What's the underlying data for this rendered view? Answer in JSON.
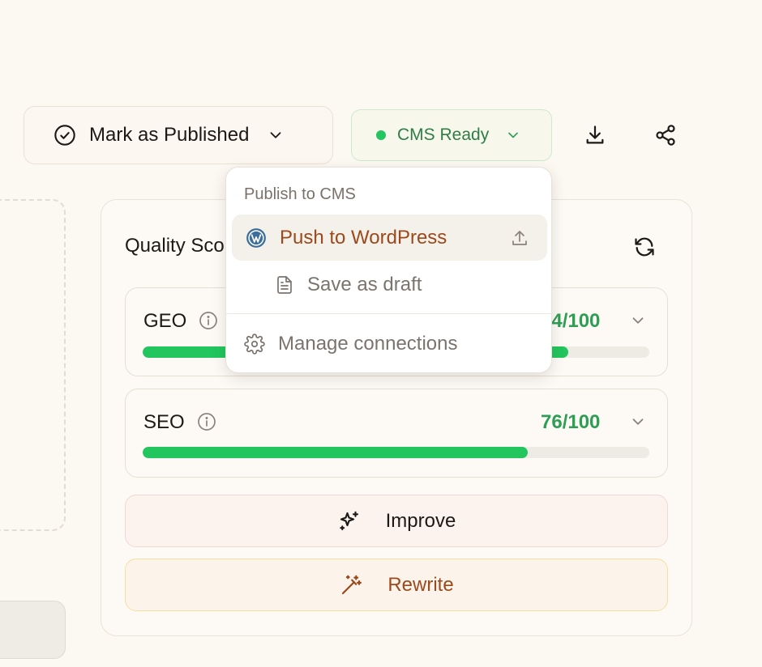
{
  "toolbar": {
    "mark_published_label": "Mark as Published",
    "cms_status_label": "CMS Ready",
    "cms_status_color": "#22c55e"
  },
  "quality": {
    "title": "Quality Score",
    "scores": [
      {
        "label": "GEO",
        "value_text": "84/100",
        "value": 84
      },
      {
        "label": "SEO",
        "value_text": "76/100",
        "value": 76
      }
    ],
    "improve_label": "Improve",
    "rewrite_label": "Rewrite"
  },
  "cms_menu": {
    "heading": "Publish to CMS",
    "push_label": "Push to WordPress",
    "draft_label": "Save as draft",
    "manage_label": "Manage connections"
  },
  "colors": {
    "accent_brown": "#9a4a1d",
    "success_green": "#22c55e",
    "background": "#fcf8f2"
  }
}
